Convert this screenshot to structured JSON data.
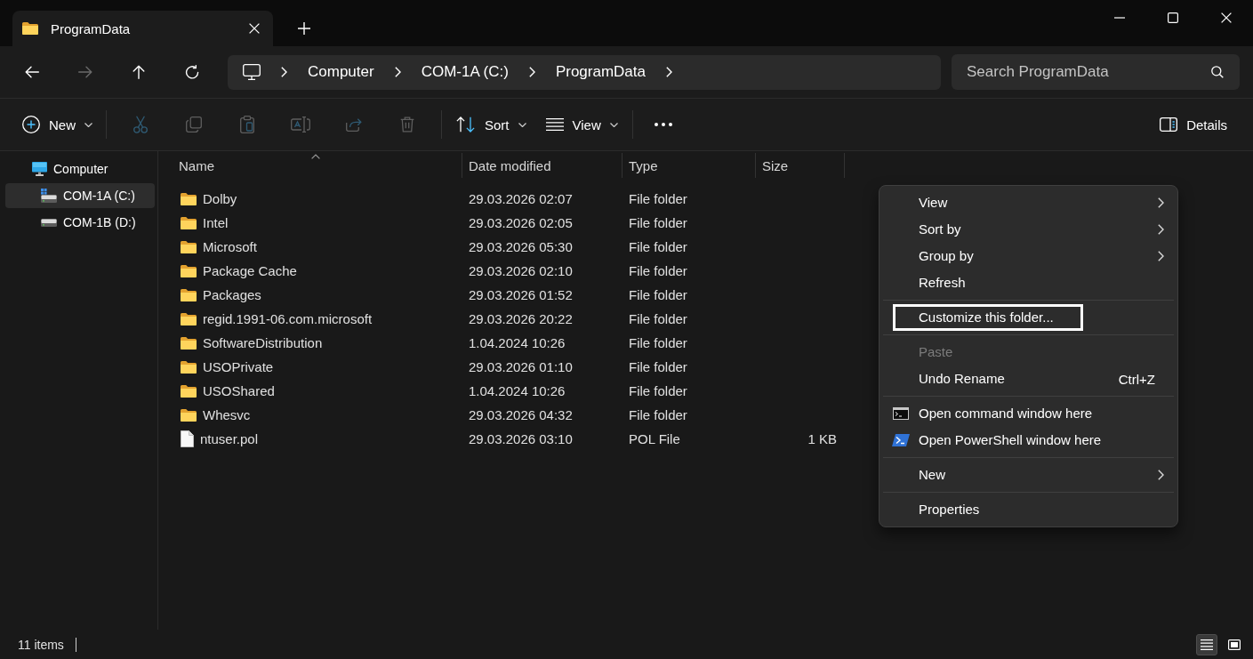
{
  "tabs": [
    {
      "title": "ProgramData",
      "selected": true
    }
  ],
  "navigation": [
    {
      "kind": "back",
      "disabled": false
    },
    {
      "kind": "forward",
      "disabled": true
    },
    {
      "kind": "up",
      "disabled": false
    },
    {
      "kind": "refresh",
      "disabled": false
    }
  ],
  "address_bar": {
    "segments": [
      "Computer",
      "COM-1A (C:)",
      "ProgramData"
    ]
  },
  "search": {
    "placeholder": "Search ProgramData"
  },
  "toolbar": {
    "items": [
      {
        "kind": "new",
        "label": "New",
        "disabled": false
      },
      {
        "kind": "separator"
      },
      {
        "kind": "cut",
        "disabled": true
      },
      {
        "kind": "copy",
        "disabled": true
      },
      {
        "kind": "paste",
        "disabled": true
      },
      {
        "kind": "rename",
        "disabled": true
      },
      {
        "kind": "share",
        "disabled": true
      },
      {
        "kind": "delete",
        "disabled": true
      },
      {
        "kind": "separator"
      },
      {
        "kind": "sort",
        "label": "Sort",
        "disabled": false
      },
      {
        "kind": "view",
        "label": "View",
        "disabled": false
      },
      {
        "kind": "separator"
      },
      {
        "kind": "more",
        "disabled": false
      }
    ],
    "details": {
      "label": "Details"
    }
  },
  "sidebar": {
    "items": [
      {
        "kind": "computer",
        "label": "Computer",
        "selected": false,
        "children": [
          {
            "kind": "system-drive",
            "label": "COM-1A (C:)",
            "selected": true
          },
          {
            "kind": "drive",
            "label": "COM-1B (D:)",
            "selected": false
          }
        ]
      }
    ]
  },
  "table": {
    "columns": [
      {
        "label": "Name",
        "sorted": true
      },
      {
        "label": "Date modified",
        "sorted": false
      },
      {
        "label": "Type",
        "sorted": false
      },
      {
        "label": "Size",
        "sorted": false
      }
    ],
    "rows": [
      {
        "kind": "folder",
        "name": "Dolby",
        "date": "29.03.2026 02:07",
        "type": "File folder"
      },
      {
        "kind": "folder",
        "name": "Intel",
        "date": "29.03.2026 02:05",
        "type": "File folder"
      },
      {
        "kind": "folder",
        "name": "Microsoft",
        "date": "29.03.2026 05:30",
        "type": "File folder"
      },
      {
        "kind": "folder",
        "name": "Package Cache",
        "date": "29.03.2026 02:10",
        "type": "File folder"
      },
      {
        "kind": "folder",
        "name": "Packages",
        "date": "29.03.2026 01:52",
        "type": "File folder"
      },
      {
        "kind": "folder",
        "name": "regid.1991-06.com.microsoft",
        "date": "29.03.2026 20:22",
        "type": "File folder"
      },
      {
        "kind": "folder",
        "name": "SoftwareDistribution",
        "date": "1.04.2024 10:26",
        "type": "File folder"
      },
      {
        "kind": "folder",
        "name": "USOPrivate",
        "date": "29.03.2026 01:10",
        "type": "File folder"
      },
      {
        "kind": "folder",
        "name": "USOShared",
        "date": "1.04.2024 10:26",
        "type": "File folder"
      },
      {
        "kind": "folder",
        "name": "Whesvc",
        "date": "29.03.2026 04:32",
        "type": "File folder"
      },
      {
        "kind": "file",
        "name": "ntuser.pol",
        "date": "29.03.2026 03:10",
        "type": "POL File",
        "size": "1 KB"
      }
    ]
  },
  "context_menu": {
    "items": [
      {
        "kind": "submenu",
        "label": "View",
        "disabled": false,
        "highlighted": false
      },
      {
        "kind": "submenu",
        "label": "Sort by",
        "disabled": false,
        "highlighted": false
      },
      {
        "kind": "submenu",
        "label": "Group by",
        "disabled": false,
        "highlighted": false
      },
      {
        "kind": "item",
        "label": "Refresh",
        "disabled": false,
        "highlighted": false
      },
      {
        "kind": "separator"
      },
      {
        "kind": "item",
        "label": "Customize this folder...",
        "disabled": false,
        "highlighted": true
      },
      {
        "kind": "separator"
      },
      {
        "kind": "item",
        "label": "Paste",
        "disabled": true,
        "highlighted": false
      },
      {
        "kind": "item",
        "label": "Undo Rename",
        "shortcut": "Ctrl+Z",
        "disabled": false,
        "highlighted": false
      },
      {
        "kind": "separator"
      },
      {
        "kind": "console",
        "label": "Open command window here",
        "disabled": false,
        "highlighted": false
      },
      {
        "kind": "shell",
        "label": "Open PowerShell window here",
        "disabled": false,
        "highlighted": false
      },
      {
        "kind": "separator"
      },
      {
        "kind": "submenu",
        "label": "New",
        "disabled": false,
        "highlighted": false
      },
      {
        "kind": "separator"
      },
      {
        "kind": "item",
        "label": "Properties",
        "disabled": false,
        "highlighted": false
      }
    ]
  },
  "status_bar": {
    "text": "11 items",
    "views": [
      {
        "kind": "details",
        "selected": true
      },
      {
        "kind": "tiles",
        "selected": false
      }
    ]
  }
}
